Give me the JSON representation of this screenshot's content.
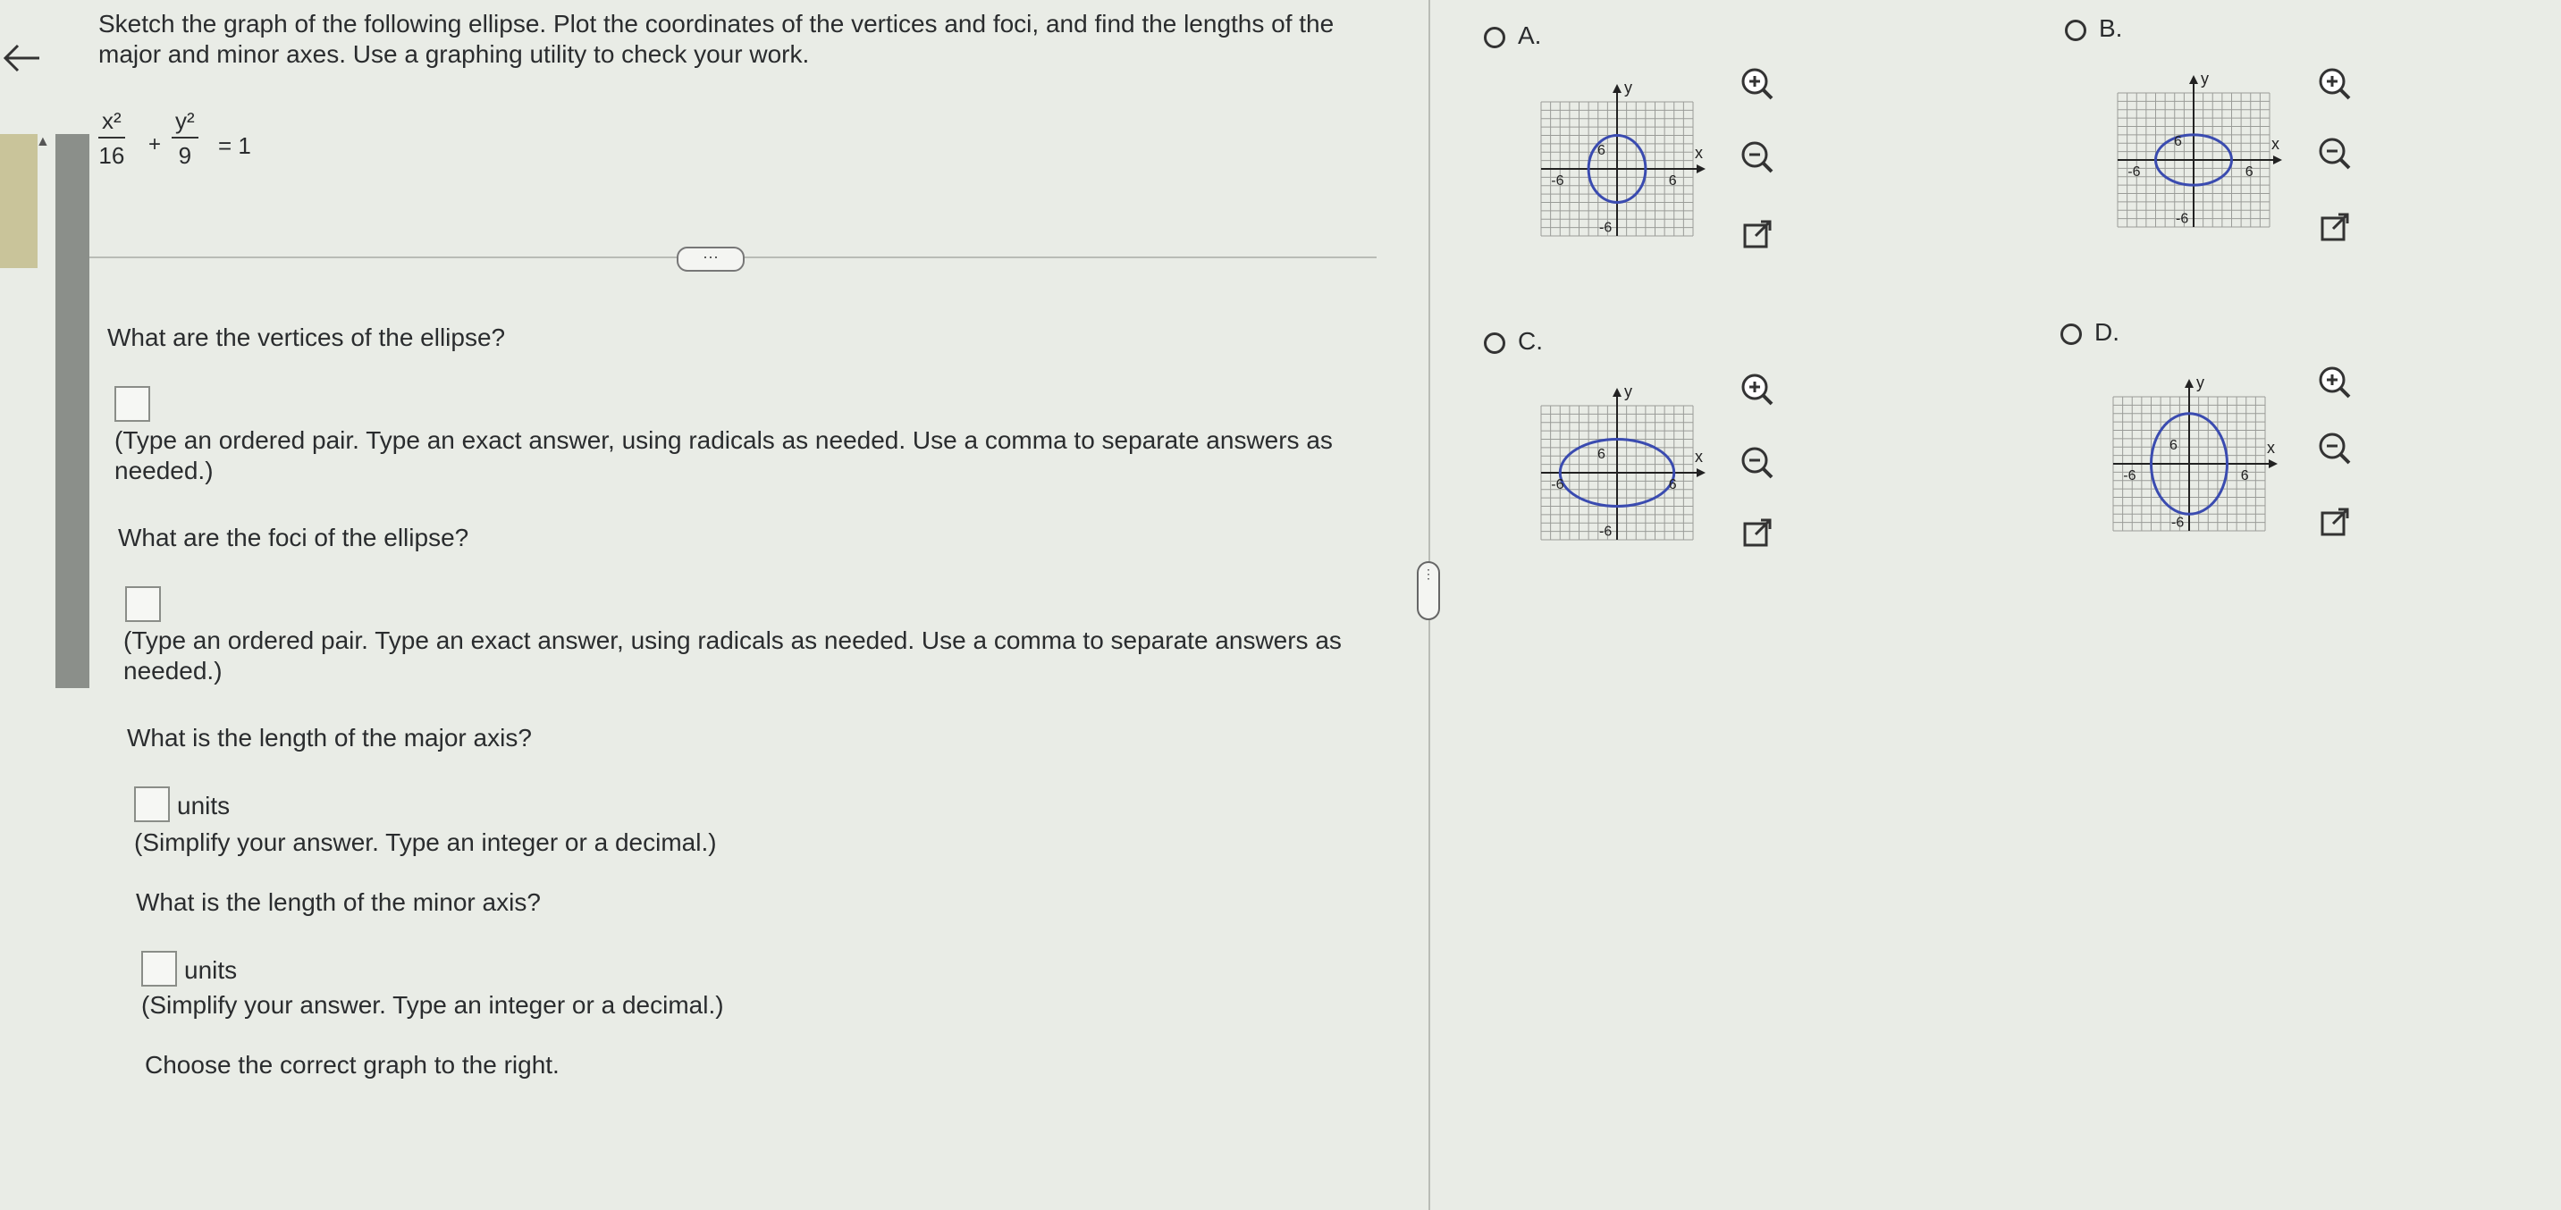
{
  "question": {
    "prompt": "Sketch the graph of the following ellipse. Plot the coordinates of the vertices and foci, and find the lengths of the major and minor axes. Use a graphing utility to check your work.",
    "equation": {
      "x_num": "x²",
      "x_den": "16",
      "plus": "+",
      "y_num": "y²",
      "y_den": "9",
      "rhs": "= 1"
    },
    "more_label": "···"
  },
  "parts": [
    {
      "question": "What are the vertices of the ellipse?",
      "value": "",
      "units": "",
      "hint": "(Type an ordered pair. Type an exact answer, using radicals as needed. Use a comma to separate answers as needed.)"
    },
    {
      "question": "What are the foci of the ellipse?",
      "value": "",
      "units": "",
      "hint": "(Type an ordered pair. Type an exact answer, using radicals as needed. Use a comma to separate answers as needed.)"
    },
    {
      "question": "What is the length of the major axis?",
      "value": "",
      "units": "units",
      "hint": "(Simplify your answer. Type an integer or a decimal.)"
    },
    {
      "question": "What is the length of the minor axis?",
      "value": "",
      "units": "units",
      "hint": "(Simplify your answer. Type an integer or a decimal.)"
    }
  ],
  "choose_prompt": "Choose the correct graph to the right.",
  "options": [
    {
      "letter": "A.",
      "ellipse_rx": 3,
      "ellipse_ry": 4,
      "axis_label_x": "x",
      "axis_label_y": "y",
      "tick_pos": "6",
      "tick_neg": "-6"
    },
    {
      "letter": "B.",
      "ellipse_rx": 4,
      "ellipse_ry": 3,
      "axis_label_x": "x",
      "axis_label_y": "y",
      "tick_pos": "6",
      "tick_neg": "-6"
    },
    {
      "letter": "C.",
      "ellipse_rx": 6,
      "ellipse_ry": 4,
      "axis_label_x": "x",
      "axis_label_y": "y",
      "tick_pos": "6",
      "tick_neg": "-6"
    },
    {
      "letter": "D.",
      "ellipse_rx": 4,
      "ellipse_ry": 6,
      "axis_label_x": "x",
      "axis_label_y": "y",
      "tick_pos": "6",
      "tick_neg": "-6"
    }
  ],
  "icons": {
    "back": "back-arrow-icon",
    "zoom_in": "zoom-in-icon",
    "zoom_out": "zoom-out-icon",
    "popout": "popout-icon"
  },
  "colors": {
    "ellipse": "#3a4bb0",
    "grid": "#9a9c98",
    "axis": "#222222"
  }
}
